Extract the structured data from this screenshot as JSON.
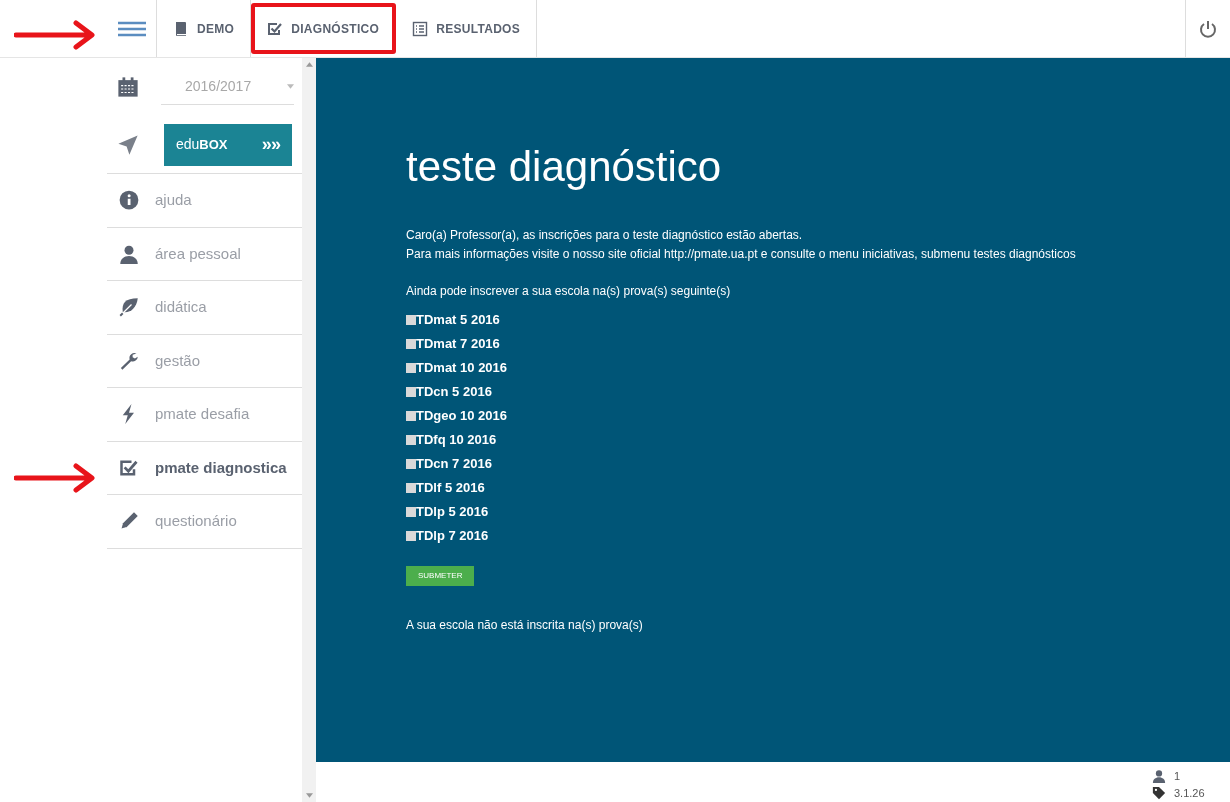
{
  "topbar": {
    "tabs": [
      {
        "kind": "book",
        "label": "DEMO",
        "highlighted": false
      },
      {
        "kind": "check",
        "label": "DIAGNÓSTICO",
        "highlighted": true
      },
      {
        "kind": "list",
        "label": "RESULTADOS",
        "highlighted": false
      }
    ]
  },
  "sidebar": {
    "year": "2016/2017",
    "logo": {
      "left": "edu",
      "right": "BOX",
      "chevrons": "»»"
    },
    "items": [
      {
        "label": "ajuda",
        "selected": false
      },
      {
        "label": "área pessoal",
        "selected": false
      },
      {
        "label": "didática",
        "selected": false
      },
      {
        "label": "gestão",
        "selected": false
      },
      {
        "label": "pmate desafia",
        "selected": false
      },
      {
        "label": "pmate diagnostica",
        "selected": true
      },
      {
        "label": "questionário",
        "selected": false
      }
    ]
  },
  "main": {
    "title": "teste diagnóstico",
    "intro": [
      "Caro(a) Professor(a), as inscrições para o teste diagnóstico estão abertas.",
      "Para mais informações visite o nosso site oficial http://pmate.ua.pt e consulte o menu iniciativas, submenu testes diagnósticos"
    ],
    "prompt": "Ainda pode inscrever a sua escola na(s) prova(s) seguinte(s)",
    "tests": [
      {
        "label": "TDmat 5 2016",
        "checked": false
      },
      {
        "label": "TDmat 7 2016",
        "checked": false
      },
      {
        "label": "TDmat 10 2016",
        "checked": false
      },
      {
        "label": "TDcn 5 2016",
        "checked": false
      },
      {
        "label": "TDgeo 10 2016",
        "checked": false
      },
      {
        "label": "TDfq 10 2016",
        "checked": false
      },
      {
        "label": "TDcn 7 2016",
        "checked": false
      },
      {
        "label": "TDlf 5 2016",
        "checked": false
      },
      {
        "label": "TDlp 5 2016",
        "checked": false
      },
      {
        "label": "TDlp 7 2016",
        "checked": false
      }
    ],
    "submit": "SUBMETER",
    "footnote": "A sua escola não está inscrita na(s) prova(s)"
  },
  "footer": {
    "users": "1",
    "version": "3.1.26"
  },
  "annotations": [
    {
      "kind": "arrow"
    },
    {
      "kind": "arrow"
    }
  ]
}
